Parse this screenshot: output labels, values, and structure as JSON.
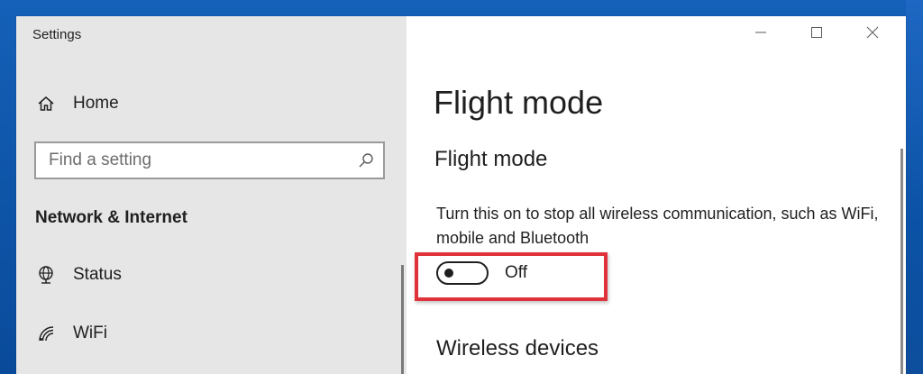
{
  "window": {
    "title": "Settings"
  },
  "titlebar": {
    "minimize_icon": "minimize-icon",
    "maximize_icon": "maximize-icon",
    "close_icon": "close-icon"
  },
  "sidebar": {
    "home": {
      "label": "Home",
      "icon": "home-icon"
    },
    "search": {
      "placeholder": "Find a setting",
      "value": "",
      "icon": "search-icon"
    },
    "section_heading": "Network & Internet",
    "items": [
      {
        "label": "Status",
        "icon": "globe-icon"
      },
      {
        "label": "WiFi",
        "icon": "wifi-icon"
      }
    ]
  },
  "main": {
    "page_title": "Flight mode",
    "sections": {
      "flight_mode": {
        "heading": "Flight mode",
        "description": "Turn this on to stop all wireless communication, such as WiFi, mobile and Bluetooth",
        "toggle_state": "Off",
        "toggle_on": false
      },
      "wireless_devices": {
        "heading": "Wireless devices"
      }
    }
  },
  "colors": {
    "sidebar_bg": "#e6e6e6",
    "content_bg": "#ffffff",
    "highlight": "#e0323a",
    "text": "#1f1f1f",
    "wallpaper": "#0e55a8"
  }
}
